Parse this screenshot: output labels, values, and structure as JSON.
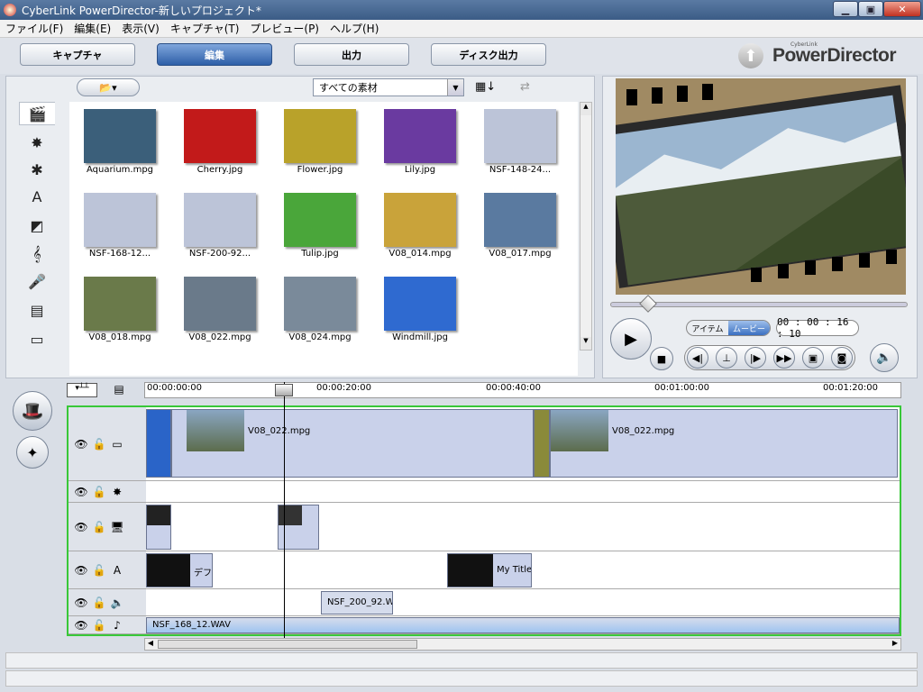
{
  "window": {
    "title": "CyberLink PowerDirector-新しいプロジェクト*"
  },
  "menu": [
    "ファイル(F)",
    "編集(E)",
    "表示(V)",
    "キャプチャ(T)",
    "プレビュー(P)",
    "ヘルプ(H)"
  ],
  "modes": {
    "capture": "キャプチャ",
    "edit": "編集",
    "produce": "出力",
    "disc": "ディスク出力",
    "active": "edit"
  },
  "brand": {
    "name": "PowerDirector",
    "small": "CyberLink"
  },
  "library": {
    "filter_value": "すべての素材",
    "items": [
      {
        "name": "Aquarium.mpg",
        "color": "#3b5f7a"
      },
      {
        "name": "Cherry.jpg",
        "color": "#c21a1a"
      },
      {
        "name": "Flower.jpg",
        "color": "#b9a22a"
      },
      {
        "name": "Lily.jpg",
        "color": "#6a3aa0"
      },
      {
        "name": "NSF-148-24...",
        "color": "#bcc4d8"
      },
      {
        "name": "NSF-168-12...",
        "color": "#bcc4d8"
      },
      {
        "name": "NSF-200-92...",
        "color": "#bcc4d8"
      },
      {
        "name": "Tulip.jpg",
        "color": "#4aa63a"
      },
      {
        "name": "V08_014.mpg",
        "color": "#c9a33a"
      },
      {
        "name": "V08_017.mpg",
        "color": "#5a7aa0"
      },
      {
        "name": "V08_018.mpg",
        "color": "#6a7a4a"
      },
      {
        "name": "V08_022.mpg",
        "color": "#6a7a8a"
      },
      {
        "name": "V08_024.mpg",
        "color": "#7a8a9a"
      },
      {
        "name": "Windmill.jpg",
        "color": "#2f6ad0"
      }
    ]
  },
  "preview": {
    "mode_item": "アイテム",
    "mode_movie": "ムービー",
    "timecode": "00 : 00 : 16 : 10"
  },
  "ruler": [
    "00:00:00:00",
    "00:00:20:00",
    "00:00:40:00",
    "00:01:00:00",
    "00:01:20:00"
  ],
  "tracks": {
    "video_clip1": "V08_022.mpg",
    "video_clip2": "V08_022.mpg",
    "title_clip1": "デフ",
    "title_clip2": "My Title",
    "voice_clip": "NSF_200_92.W",
    "music_clip": "NSF_168_12.WAV"
  }
}
